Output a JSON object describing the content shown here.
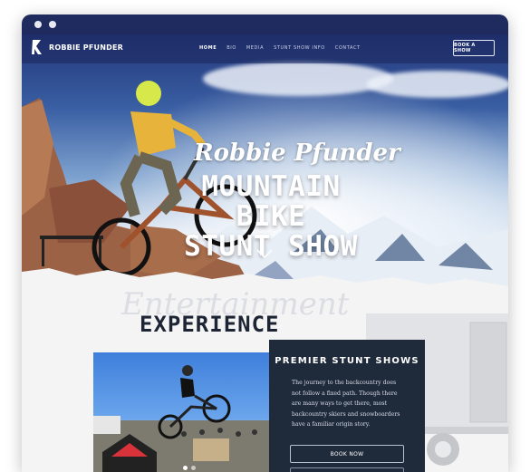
{
  "brand": {
    "name": "ROBBIE PFUNDER"
  },
  "nav": {
    "items": [
      "HOME",
      "BIO",
      "MEDIA",
      "STUNT SHOW INFO",
      "CONTACT"
    ],
    "active": "HOME"
  },
  "header": {
    "cta_label": "BOOK A SHOW"
  },
  "hero": {
    "script_title": "Robbie Pfunder",
    "headline_line1": "MOUNTAIN BIKE",
    "headline_line2": "STUNT SHOW"
  },
  "section": {
    "watermark": "Entertainment",
    "heading": "EXPERIENCE"
  },
  "card": {
    "title": "PREMIER STUNT SHOWS",
    "body": "The journey to the backcountry does not follow a fixed path. Though there are many ways to get there, most backcountry skiers and snowboarders have a familiar origin story.",
    "button_label": "BOOK NOW"
  },
  "colors": {
    "navy": "#1f2b5e",
    "card_bg": "#1f2a3b",
    "text_dark": "#1d2433"
  },
  "icons": {
    "logo": "rp-logo-icon",
    "scroll": "chevron-down-icon"
  }
}
